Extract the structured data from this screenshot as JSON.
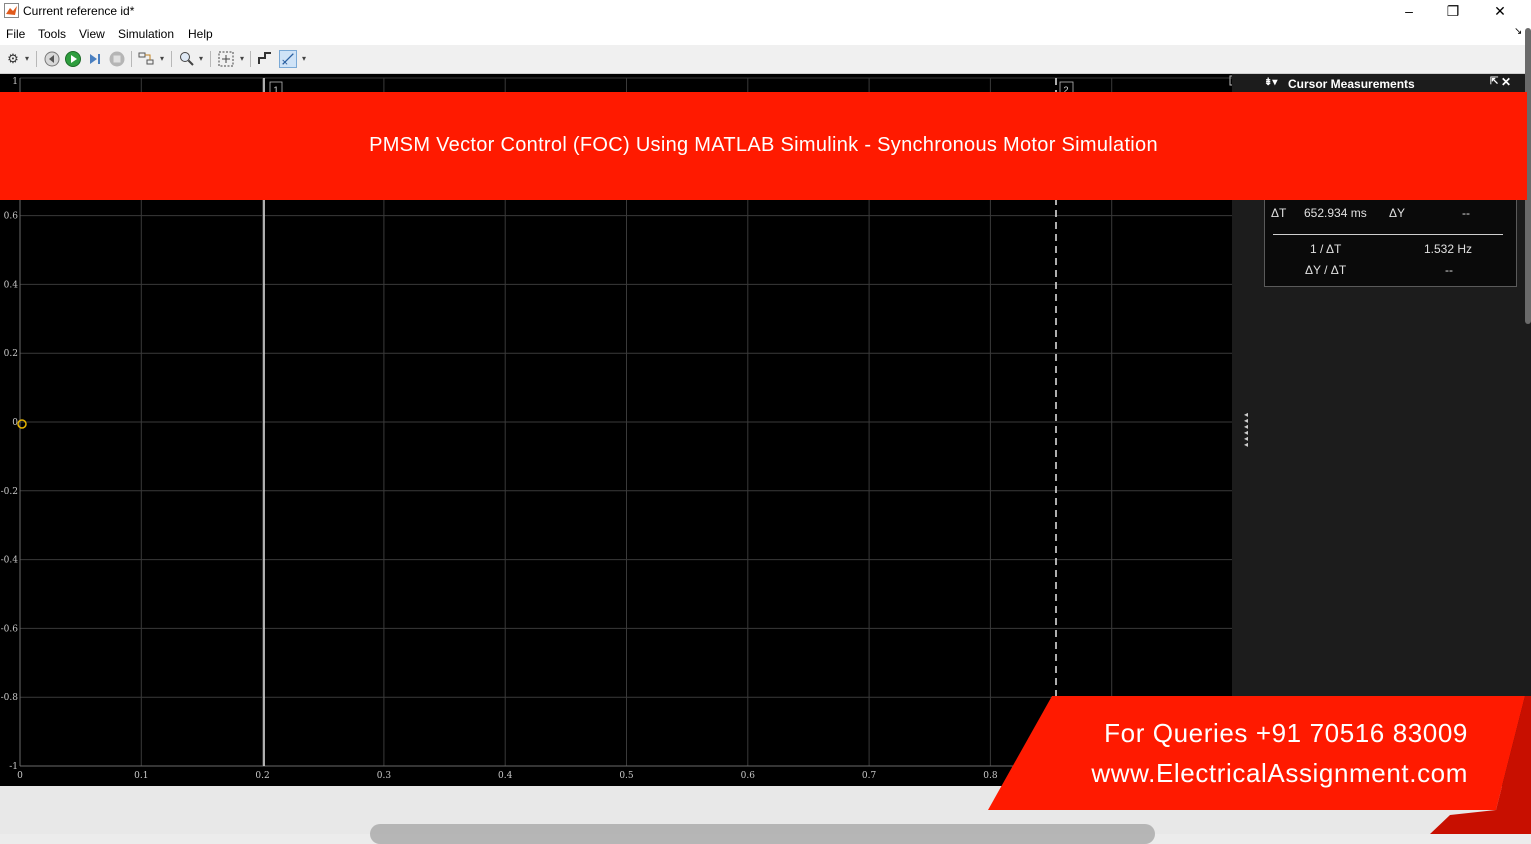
{
  "window": {
    "title": "Current reference id*",
    "minimize_glyph": "–",
    "restore_glyph": "❐",
    "close_glyph": "✕"
  },
  "menu": [
    "File",
    "Tools",
    "View",
    "Simulation",
    "Help"
  ],
  "toolbar": {
    "icons": [
      "settings-icon",
      "step-back-icon",
      "run-icon",
      "step-forward-icon",
      "stop-icon",
      "highlight-block-icon",
      "zoom-icon",
      "fit-to-view-icon",
      "trigger-icon",
      "cursor-measure-icon"
    ]
  },
  "plot": {
    "x_ticks": [
      "0",
      "0.1",
      "0.2",
      "0.3",
      "0.4",
      "0.5",
      "0.6",
      "0.7",
      "0.8"
    ],
    "y_ticks": [
      "1",
      "0.6",
      "0.4",
      "0.2",
      "0",
      "-0.2",
      "-0.4",
      "-0.6",
      "-0.8",
      "-1"
    ],
    "cursor1_label": "1",
    "cursor2_label": "2",
    "colors": {
      "background": "#000000",
      "grid": "#3a3a3a",
      "tick_text": "#c8c8c8"
    }
  },
  "cursor_measurements": {
    "title": "Cursor Measurements",
    "dt_label": "ΔT",
    "dt_value": "652.934 ms",
    "dy_label": "ΔY",
    "dy_value": "--",
    "inv_dt_label": "1 / ΔT",
    "inv_dt_value": "1.532 Hz",
    "dy_dt_label": "ΔY / ΔT",
    "dy_dt_value": "--"
  },
  "banner": {
    "text": "PMSM Vector Control (FOC) Using MATLAB Simulink - Synchronous Motor Simulation",
    "color": "#ff1a00"
  },
  "promo": {
    "line1": "For Queries +91 70516 83009",
    "line2": "www.ElectricalAssignment.com",
    "color": "#ff1a00"
  }
}
